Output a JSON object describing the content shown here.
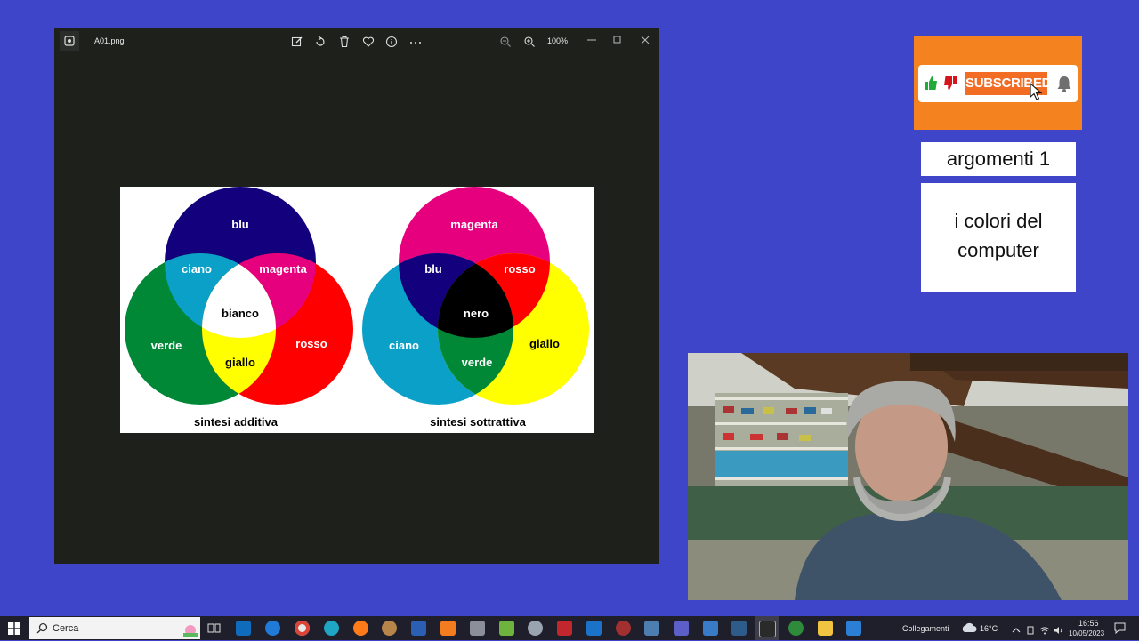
{
  "viewer": {
    "filename": "A01.png",
    "zoom": "100%",
    "toolbar": [
      "edit-icon",
      "rotate-icon",
      "delete-icon",
      "favorite-icon",
      "info-icon",
      "more-icon"
    ],
    "image": {
      "additive": {
        "blue": "blu",
        "cyan": "ciano",
        "magenta": "magenta",
        "white": "bianco",
        "green": "verde",
        "red": "rosso",
        "yellow": "giallo",
        "caption": "sintesi additiva"
      },
      "subtractive": {
        "magenta": "magenta",
        "blue": "blu",
        "red": "rosso",
        "black": "nero",
        "cyan": "ciano",
        "yellow": "giallo",
        "green": "verde",
        "caption": "sintesi sottrattiva"
      },
      "colors": {
        "blue": "#13007c",
        "cyan": "#0aa0c8",
        "magenta": "#e6007e",
        "green": "#008837",
        "red": "#ff0000",
        "yellow": "#ffff00"
      }
    }
  },
  "subscribe": {
    "label": "SUBSCRIBED",
    "icons": [
      "thumbs-up-icon",
      "thumbs-down-icon",
      "bell-icon",
      "cursor-icon"
    ],
    "accent": "#f3821f"
  },
  "sidebar": {
    "topic": "argomenti 1",
    "title": "i colori del computer"
  },
  "taskbar": {
    "search_placeholder": "Cerca",
    "links": "Collegamenti",
    "temperature": "16°C",
    "time": "16:56",
    "date": "10/05/2023"
  }
}
